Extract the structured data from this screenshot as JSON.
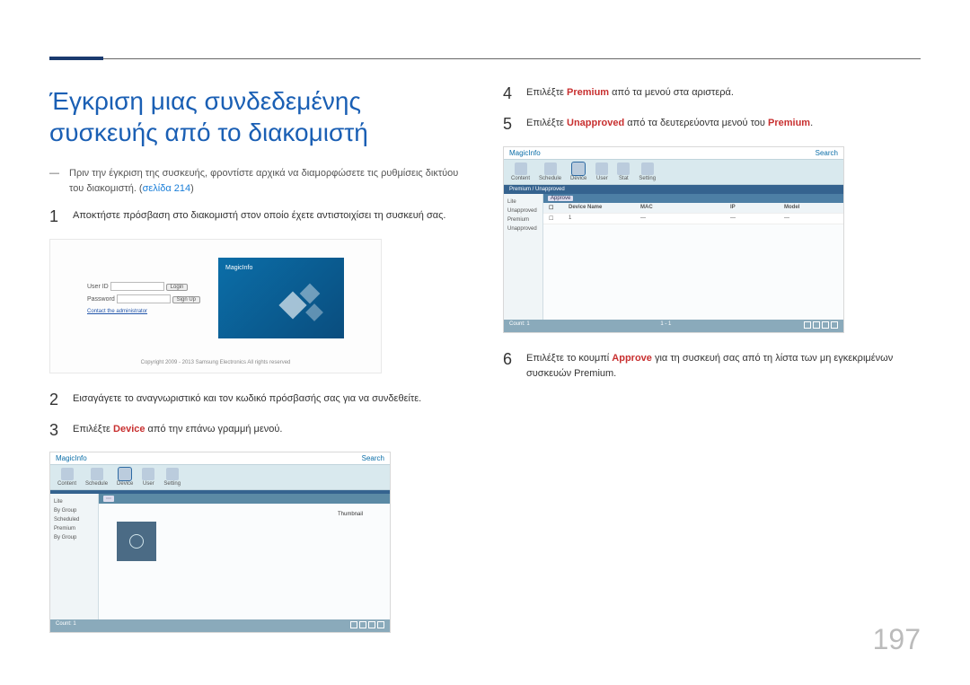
{
  "page_number": "197",
  "heading": "Έγκριση μιας συνδεδεμένης συσκευής από το διακομιστή",
  "note_prefix": "Πριν την έγκριση της συσκευής, φροντίστε αρχικά να διαμορφώσετε τις ρυθμίσεις δικτύου του διακομιστή. (",
  "note_link": "σελίδα 214",
  "note_suffix": ")",
  "steps": {
    "s1": {
      "num": "1",
      "text": "Αποκτήστε πρόσβαση στο διακομιστή στον οποίο έχετε αντιστοιχίσει τη συσκευή σας."
    },
    "s2": {
      "num": "2",
      "text": "Εισαγάγετε το αναγνωριστικό και τον κωδικό πρόσβασής σας για να συνδεθείτε."
    },
    "s3": {
      "num": "3",
      "pre": "Επιλέξτε ",
      "kw": "Device",
      "post": " από την επάνω γραμμή μενού."
    },
    "s4": {
      "num": "4",
      "pre": "Επιλέξτε ",
      "kw": "Premium",
      "post": " από τα μενού στα αριστερά."
    },
    "s5": {
      "num": "5",
      "pre": "Επιλέξτε ",
      "kw": "Unapproved",
      "post_a": " από τα δευτερεύοντα μενού του ",
      "kw2": "Premium",
      "post_b": "."
    },
    "s6": {
      "num": "6",
      "pre": "Επιλέξτε το κουμπί ",
      "kw": "Approve",
      "post": " για τη συσκευή σας από τη λίστα των μη εγκεκριμένων συσκευών Premium."
    }
  },
  "login_mock": {
    "user_label": "User ID",
    "pass_label": "Password",
    "login_btn": "Login",
    "signup_btn": "Sign Up",
    "admin_link": "Contact the administrator",
    "brand": "MagicInfo",
    "copyright": "Copyright 2009 - 2013 Samsung Electronics All rights reserved"
  },
  "app_mock": {
    "brand": "MagicInfo",
    "toolbar": [
      "Content",
      "Schedule",
      "Device",
      "User",
      "Setting"
    ],
    "toolbar2": [
      "Content",
      "Schedule",
      "Device",
      "User",
      "Stat",
      "Setting"
    ],
    "sidebar_a": [
      "Lite",
      "By Group",
      "Scheduled",
      "Premium",
      "By Group"
    ],
    "sidebar_b": [
      "Lite",
      "Unapproved",
      "Premium",
      "Unapproved"
    ],
    "approve_btn": "Approve",
    "search_label": "Search",
    "subbar_label": "Premium / Unapproved",
    "status_count": "Count: 1",
    "status_range": "1 - 1"
  }
}
